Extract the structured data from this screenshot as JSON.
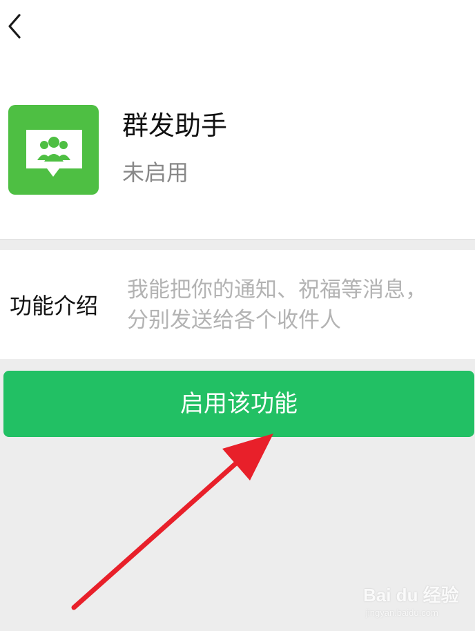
{
  "header": {
    "back_icon": "chevron-left-icon"
  },
  "app": {
    "icon": "group-chat-icon",
    "title": "群发助手",
    "status": "未启用"
  },
  "intro": {
    "label": "功能介绍",
    "lines": [
      "我能把你的通知、祝福等消息，",
      "分别发送给各个收件人"
    ]
  },
  "actions": {
    "enable_label": "启用该功能"
  },
  "annotation": {
    "arrow_color": "#e8202a"
  },
  "watermark": {
    "logo_text": "Bai du 经验",
    "url": "jingyan.baidu.com"
  },
  "colors": {
    "accent": "#22c064",
    "icon_bg": "#4ebf43",
    "page_bg": "#ededed",
    "hint_text": "#b3b3b3"
  }
}
